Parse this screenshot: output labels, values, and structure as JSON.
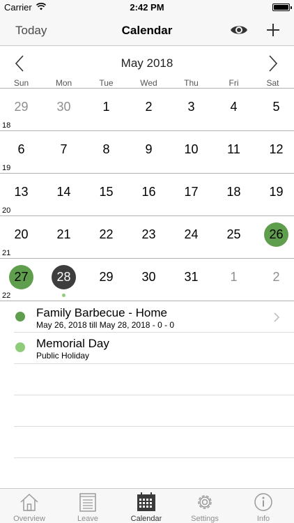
{
  "status_bar": {
    "carrier": "Carrier",
    "time": "2:42 PM"
  },
  "nav": {
    "today_label": "Today",
    "title": "Calendar",
    "eye_icon": "eye-icon",
    "add_icon": "plus-icon"
  },
  "calendar": {
    "month_title": "May 2018",
    "weekdays": [
      "Sun",
      "Mon",
      "Tue",
      "Wed",
      "Thu",
      "Fri",
      "Sat"
    ],
    "weeks": [
      {
        "week_number": "18",
        "days": [
          "29",
          "30",
          "1",
          "2",
          "3",
          "4",
          "5"
        ]
      },
      {
        "week_number": "19",
        "days": [
          "6",
          "7",
          "8",
          "9",
          "10",
          "11",
          "12"
        ]
      },
      {
        "week_number": "20",
        "days": [
          "13",
          "14",
          "15",
          "16",
          "17",
          "18",
          "19"
        ]
      },
      {
        "week_number": "21",
        "days": [
          "20",
          "21",
          "22",
          "23",
          "24",
          "25",
          "26"
        ]
      },
      {
        "week_number": "22",
        "days": [
          "27",
          "28",
          "29",
          "30",
          "31",
          "1",
          "2"
        ]
      }
    ],
    "colors": {
      "event_day": "#5f9e4c",
      "today": "#3d3d3d",
      "event_dot": "#8fcc7a"
    }
  },
  "events": [
    {
      "title": "Family Barbecue - Home",
      "subtitle": "May 26, 2018 till May 28, 2018 - 0 - 0",
      "color": "#5f9e4c"
    },
    {
      "title": "Memorial Day",
      "subtitle": "Public Holiday",
      "color": "#8fcc7a"
    }
  ],
  "tabs": [
    {
      "label": "Overview",
      "icon": "house-icon"
    },
    {
      "label": "Leave",
      "icon": "notepad-icon"
    },
    {
      "label": "Calendar",
      "icon": "calendar-icon"
    },
    {
      "label": "Settings",
      "icon": "gear-icon"
    },
    {
      "label": "Info",
      "icon": "info-icon"
    }
  ]
}
